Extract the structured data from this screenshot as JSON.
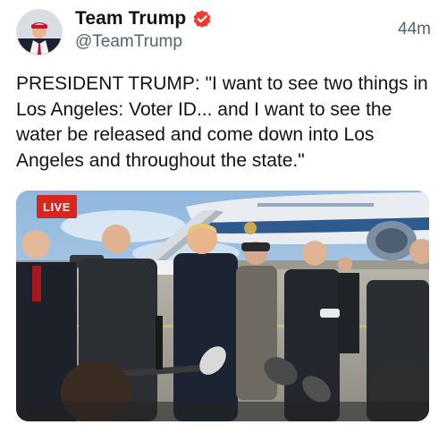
{
  "post": {
    "display_name": "Team Trump",
    "handle": "@TeamTrump",
    "time": "44m",
    "text": "PRESIDENT TRUMP: \"I want to see two things in Los Angeles: Voter ID... and I want to see the water be released and come down into Los Angeles and throughout the state.\""
  },
  "media": {
    "live_label": "LIVE"
  },
  "icons": {
    "verified": "verified-badge-icon",
    "avatar": "avatar"
  },
  "colors": {
    "verified_badge": "#ef3b2d",
    "live_badge": "#d7261e",
    "secondary_text": "#536471"
  }
}
